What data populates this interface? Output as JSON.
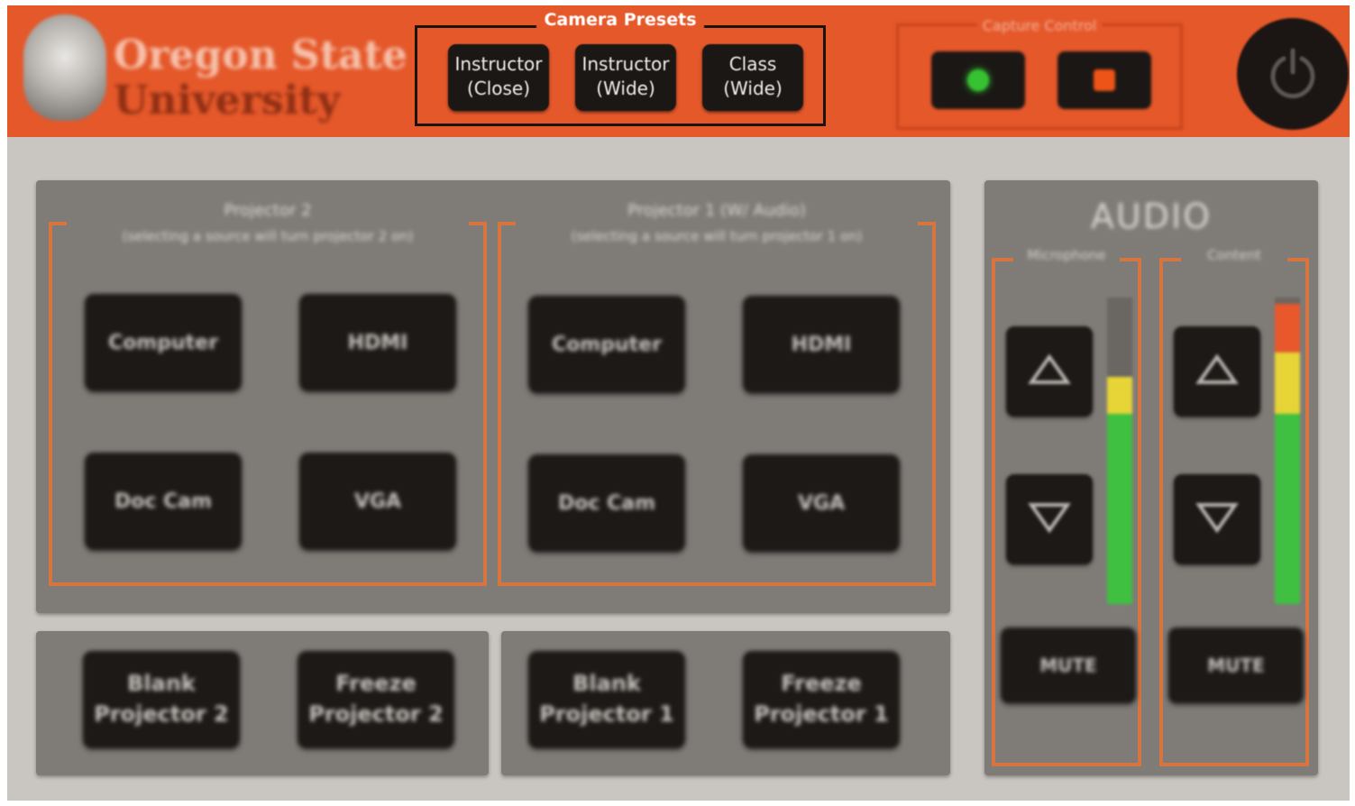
{
  "header": {
    "logo_line1": "Oregon State",
    "logo_line2": "University",
    "camera_presets": {
      "title": "Camera Presets",
      "buttons": [
        {
          "line1": "Instructor",
          "line2": "(Close)"
        },
        {
          "line1": "Instructor",
          "line2": "(Wide)"
        },
        {
          "line1": "Class",
          "line2": "(Wide)"
        }
      ]
    },
    "capture": {
      "title": "Capture Control",
      "record_color": "#37c232",
      "stop_color": "#ec5418"
    },
    "power_icon": "power-icon"
  },
  "projectors": {
    "projector2": {
      "title": "Projector 2",
      "subtitle": "(selecting a source will turn projector 2 on)",
      "sources": [
        "Computer",
        "HDMI",
        "Doc Cam",
        "VGA"
      ],
      "blank": {
        "line1": "Blank",
        "line2": "Projector 2"
      },
      "freeze": {
        "line1": "Freeze",
        "line2": "Projector 2"
      }
    },
    "projector1": {
      "title": "Projector 1 (W/ Audio)",
      "subtitle": "(selecting a source will turn projector 1 on)",
      "sources": [
        "Computer",
        "HDMI",
        "Doc Cam",
        "VGA"
      ],
      "blank": {
        "line1": "Blank",
        "line2": "Projector 1"
      },
      "freeze": {
        "line1": "Freeze",
        "line2": "Projector 1"
      }
    }
  },
  "audio": {
    "title": "AUDIO",
    "channels": [
      {
        "label": "Microphone",
        "mute_label": "MUTE",
        "level": 0.74,
        "up_icon": "triangle-up-icon",
        "down_icon": "triangle-down-icon"
      },
      {
        "label": "Content",
        "mute_label": "MUTE",
        "level": 0.98,
        "up_icon": "triangle-up-icon",
        "down_icon": "triangle-down-icon"
      }
    ]
  },
  "colors": {
    "header_orange": "#e5582a",
    "panel_gray": "#7f7b77",
    "group_border": "#d8743f",
    "button_black": "#1c1917"
  }
}
